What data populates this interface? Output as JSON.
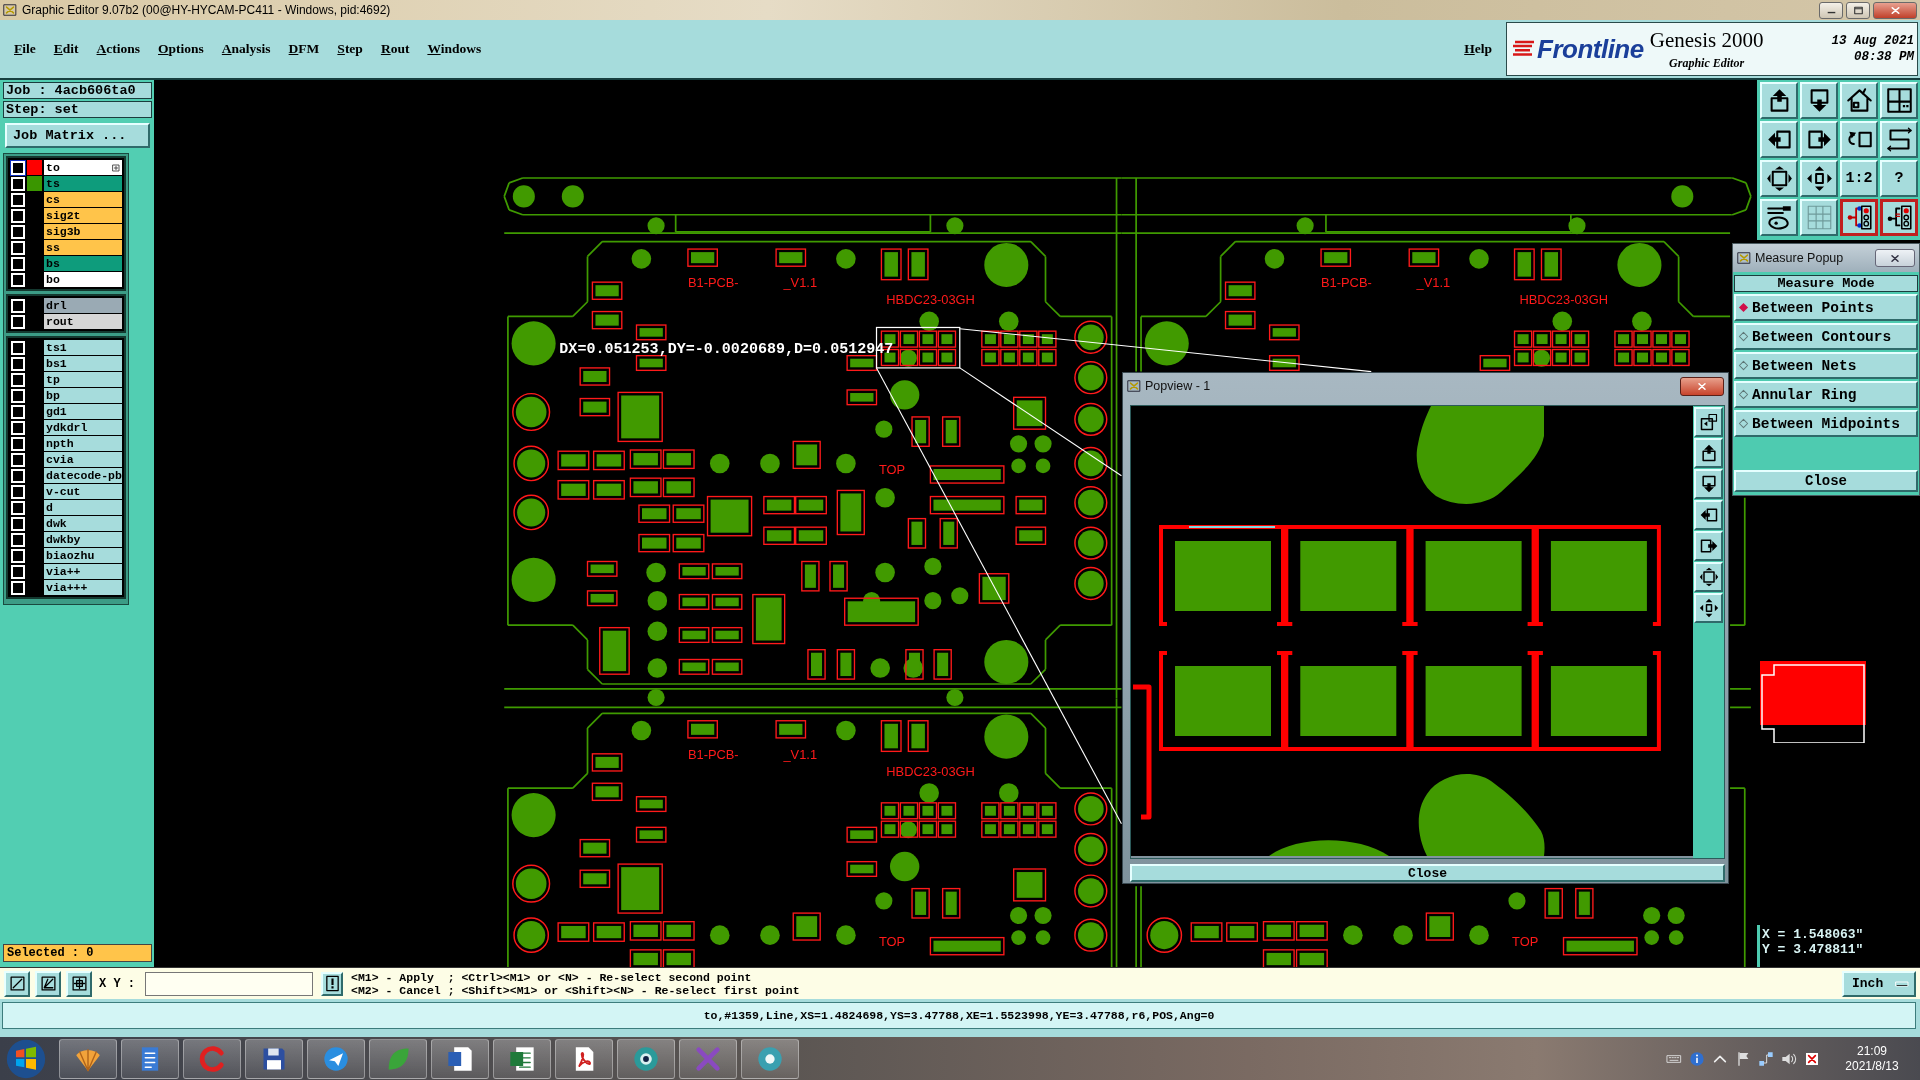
{
  "window": {
    "title": "Graphic Editor 9.07b2 (00@HY-HYCAM-PC411 - Windows, pid:4692)"
  },
  "menu": {
    "items": [
      "File",
      "Edit",
      "Actions",
      "Options",
      "Analysis",
      "DFM",
      "Step",
      "Rout",
      "Windows"
    ],
    "help": "Help"
  },
  "brand": {
    "logo": "Frontline",
    "product": "Genesis 2000",
    "subtitle": "Graphic Editor",
    "date": "13 Aug 2021",
    "time": "08:38 PM"
  },
  "job_panel": {
    "job": "Job : 4acb606ta0",
    "step": "Step: set",
    "matrix_button": "Job Matrix ...",
    "layer_groups": [
      {
        "layers": [
          {
            "name": "to",
            "kind": "silk",
            "color": "#ff0000",
            "checked": false,
            "work": true
          },
          {
            "name": "ts",
            "kind": "mask",
            "color": "#3a9600",
            "checked": false,
            "work": false
          },
          {
            "name": "cs",
            "kind": "signal",
            "checked": false,
            "work": false
          },
          {
            "name": "sig2t",
            "kind": "signal",
            "checked": false,
            "work": false
          },
          {
            "name": "sig3b",
            "kind": "signal",
            "checked": false,
            "work": false
          },
          {
            "name": "ss",
            "kind": "signal",
            "checked": false,
            "work": false
          },
          {
            "name": "bs",
            "kind": "mask",
            "checked": false,
            "work": false
          },
          {
            "name": "bo",
            "kind": "silk",
            "checked": false,
            "work": false
          }
        ]
      },
      {
        "layers": [
          {
            "name": "drl",
            "kind": "drill",
            "checked": false,
            "work": false
          },
          {
            "name": "rout",
            "kind": "rout",
            "checked": false,
            "work": false
          }
        ]
      },
      {
        "layers": [
          {
            "name": "ts1",
            "kind": "misc",
            "checked": false,
            "work": false
          },
          {
            "name": "bs1",
            "kind": "misc",
            "checked": false,
            "work": false
          },
          {
            "name": "tp",
            "kind": "misc",
            "checked": false,
            "work": false
          },
          {
            "name": "bp",
            "kind": "misc",
            "checked": false,
            "work": false
          },
          {
            "name": "gd1",
            "kind": "misc",
            "checked": false,
            "work": false
          },
          {
            "name": "ydkdrl",
            "kind": "misc",
            "checked": false,
            "work": false
          },
          {
            "name": "npth",
            "kind": "misc",
            "checked": false,
            "work": false
          },
          {
            "name": "cvia",
            "kind": "misc",
            "checked": false,
            "work": false
          },
          {
            "name": "datecode-pb",
            "kind": "misc",
            "checked": false,
            "work": false
          },
          {
            "name": "v-cut",
            "kind": "misc",
            "checked": false,
            "work": false
          },
          {
            "name": "d",
            "kind": "misc",
            "checked": false,
            "work": false
          },
          {
            "name": "dwk",
            "kind": "misc",
            "checked": false,
            "work": false
          },
          {
            "name": "dwkby",
            "kind": "misc",
            "checked": false,
            "work": false
          },
          {
            "name": "biaozhu",
            "kind": "misc",
            "checked": false,
            "work": false
          },
          {
            "name": "via++",
            "kind": "misc",
            "checked": false,
            "work": false
          },
          {
            "name": "via+++",
            "kind": "misc",
            "checked": false,
            "work": false
          }
        ]
      }
    ],
    "selected": "Selected : 0"
  },
  "canvas": {
    "measurement": "DX=0.051253,DY=-0.0020689,D=0.0512947",
    "boards": [
      {
        "name_label": "B1-PCB-",
        "version": "_V1.1",
        "part_number": "HBDC23-03GH",
        "side": "TOP"
      },
      {
        "name_label": "B1-PCB-",
        "version": "_V1.1",
        "part_number": "HBDC23-03GH"
      },
      {
        "name_label": "B1-PCB-",
        "version": "_V1.1",
        "part_number": "HBDC23-03GH",
        "side": "TOP"
      },
      {
        "side": "TOP"
      }
    ]
  },
  "toolbar": [
    {
      "kind": "icon",
      "active": false
    },
    {
      "kind": "icon",
      "active": false
    },
    {
      "kind": "icon",
      "active": false
    },
    {
      "kind": "icon",
      "active": false
    },
    {
      "kind": "icon",
      "active": false
    },
    {
      "kind": "icon",
      "active": false
    },
    {
      "kind": "icon",
      "active": false
    },
    {
      "kind": "icon",
      "active": false
    },
    {
      "kind": "icon",
      "active": false
    },
    {
      "kind": "icon",
      "active": false
    },
    {
      "kind": "text",
      "label": "1:2",
      "active": false
    },
    {
      "kind": "text",
      "label": "?",
      "active": false
    },
    {
      "kind": "icon",
      "active": false
    },
    {
      "kind": "icon",
      "active": false
    },
    {
      "kind": "icon",
      "active": true
    },
    {
      "kind": "icon",
      "active": true
    }
  ],
  "measure_popup": {
    "title": "Measure Popup",
    "heading": "Measure Mode",
    "modes": [
      {
        "label": "Between Points",
        "selected": true
      },
      {
        "label": "Between Contours",
        "selected": false
      },
      {
        "label": "Between Nets",
        "selected": false
      },
      {
        "label": "Annular Ring",
        "selected": false
      },
      {
        "label": "Between Midpoints",
        "selected": false
      }
    ],
    "close": "Close"
  },
  "popview": {
    "title": "Popview - 1",
    "close": "Close"
  },
  "coordinates": {
    "x": "X = 1.548063\"",
    "y": "Y = 3.478811\""
  },
  "command_bar": {
    "xy_label": "X Y :",
    "prompt": [
      "<M1> - Apply  ; <Ctrl><M1> or <N> - Re-select second point",
      "<M2> - Cancel ; <Shift><M1> or <Shift><N> - Re-select first point"
    ],
    "units": "Inch"
  },
  "status_bar": "to,#1359,Line,XS=1.4824698,YS=3.47788,XE=1.5523998,YE=3.47788,r6,POS,Ang=0",
  "taskbar": {
    "time": "21:09",
    "date": "2021/8/13"
  }
}
